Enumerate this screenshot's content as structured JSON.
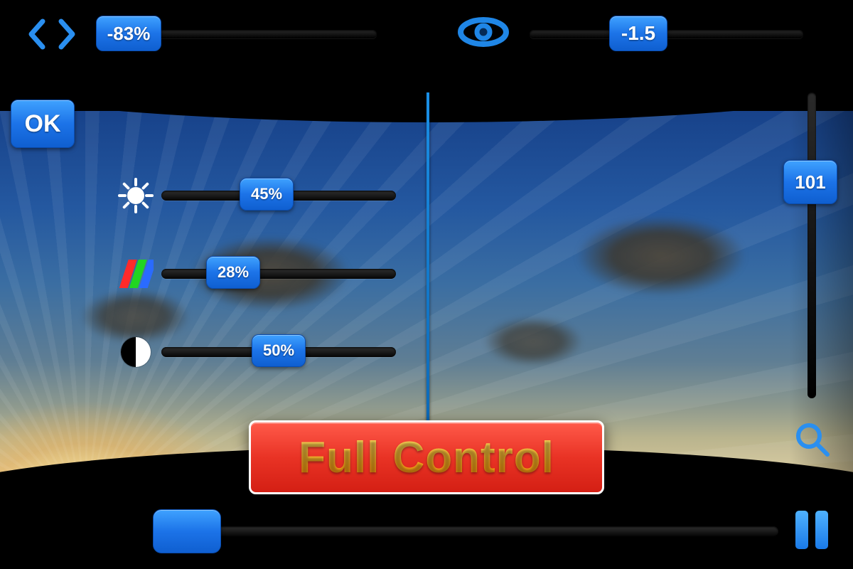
{
  "top": {
    "left_value": "-83%",
    "right_value": "-1.5"
  },
  "ok_label": "OK",
  "sliders": {
    "brightness": "45%",
    "rgb": "28%",
    "contrast": "50%"
  },
  "vertical_value": "101",
  "banner_text": "Full Control",
  "icons": {
    "nav": "nav-arrows-icon",
    "eye": "eye-icon",
    "brightness": "brightness-icon",
    "rgb": "rgb-bars-icon",
    "contrast": "contrast-icon",
    "zoom": "magnifier-icon",
    "pause": "pause-icon"
  },
  "colors": {
    "accent": "#1c73e8",
    "banner_bg": "#e93325",
    "banner_text_gradient": [
      "#ffe56b",
      "#ff8a00"
    ]
  }
}
